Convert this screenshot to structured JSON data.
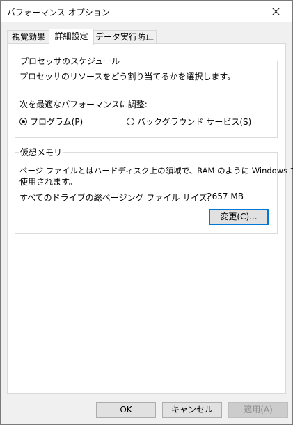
{
  "window": {
    "title": "パフォーマンス オプション"
  },
  "tabs": [
    {
      "label": "視覚効果",
      "active": false
    },
    {
      "label": "詳細設定",
      "active": true
    },
    {
      "label": "データ実行防止",
      "active": false
    }
  ],
  "processor": {
    "group_title": "プロセッサのスケジュール",
    "description": "プロセッサのリソースをどう割り当てるかを選択します。",
    "adjust_label": "次を最適なパフォーマンスに調整:",
    "options": [
      {
        "label": "プログラム(P)",
        "checked": true
      },
      {
        "label": "バックグラウンド サービス(S)",
        "checked": false
      }
    ]
  },
  "virtual_memory": {
    "group_title": "仮想メモリ",
    "description_line1": "ページ ファイルとはハードディスク上の領域で、RAM のように Windows で",
    "description_line2": "使用されます。",
    "total_label": "すべてのドライブの総ページング ファイル サイズ:",
    "total_value": "2657 MB",
    "change_button": "変更(C)..."
  },
  "footer": {
    "ok": "OK",
    "cancel": "キャンセル",
    "apply": "適用(A)"
  }
}
